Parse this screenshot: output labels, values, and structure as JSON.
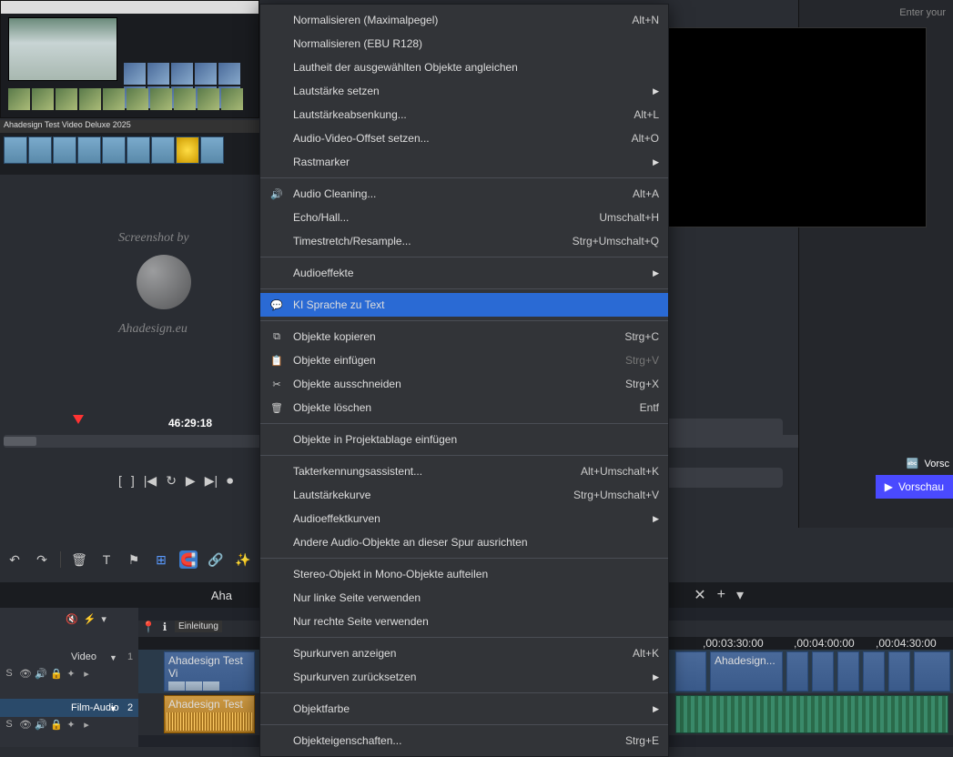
{
  "preview": {
    "title": "Ahadesign Test Video Deluxe 2025"
  },
  "watermark": {
    "top": "Screenshot by",
    "bottom": "Ahadesign.eu"
  },
  "timecode": "46:29:18",
  "rightPanel": {
    "placeholder": "Enter your",
    "translate_label": "Vorsc",
    "preview_btn": "Vorschau"
  },
  "tab": {
    "name": "Aha"
  },
  "tracks": {
    "marker_label": "Einleitung",
    "video_label": "Video",
    "video_num": "1",
    "audio_label": "Film-Audio",
    "audio_num": "2",
    "clip1": "Ahadesign Test Vi",
    "clip2": "Ahadesign Test V",
    "clip3": "Ahadesign..."
  },
  "ruler": {
    "t1": ",00:03:30:00",
    "t2": ",00:04:00:00",
    "t3": ",00:04:30:00"
  },
  "contextMenu": [
    {
      "type": "item",
      "label": "Normalisieren (Maximalpegel)",
      "shortcut": "Alt+N"
    },
    {
      "type": "item",
      "label": "Normalisieren (EBU R128)"
    },
    {
      "type": "item",
      "label": "Lautheit der ausgewählten Objekte angleichen",
      "disabled": true
    },
    {
      "type": "item",
      "label": "Lautstärke setzen",
      "submenu": true
    },
    {
      "type": "item",
      "label": "Lautstärkeabsenkung...",
      "shortcut": "Alt+L"
    },
    {
      "type": "item",
      "label": "Audio-Video-Offset setzen...",
      "shortcut": "Alt+O"
    },
    {
      "type": "item",
      "label": "Rastmarker",
      "submenu": true
    },
    {
      "type": "sep"
    },
    {
      "type": "item",
      "label": "Audio Cleaning...",
      "shortcut": "Alt+A",
      "icon": "sound"
    },
    {
      "type": "item",
      "label": "Echo/Hall...",
      "shortcut": "Umschalt+H"
    },
    {
      "type": "item",
      "label": "Timestretch/Resample...",
      "shortcut": "Strg+Umschalt+Q"
    },
    {
      "type": "sep"
    },
    {
      "type": "item",
      "label": "Audioeffekte",
      "submenu": true
    },
    {
      "type": "sep"
    },
    {
      "type": "item",
      "label": "KI Sprache zu Text",
      "highlighted": true,
      "icon": "speech"
    },
    {
      "type": "sep"
    },
    {
      "type": "item",
      "label": "Objekte kopieren",
      "shortcut": "Strg+C",
      "icon": "copy"
    },
    {
      "type": "item",
      "label": "Objekte einfügen",
      "shortcut": "Strg+V",
      "icon": "paste",
      "disabled": true
    },
    {
      "type": "item",
      "label": "Objekte ausschneiden",
      "shortcut": "Strg+X",
      "icon": "cut"
    },
    {
      "type": "item",
      "label": "Objekte löschen",
      "shortcut": "Entf",
      "icon": "delete"
    },
    {
      "type": "sep"
    },
    {
      "type": "item",
      "label": "Objekte in Projektablage einfügen"
    },
    {
      "type": "sep"
    },
    {
      "type": "item",
      "label": "Takterkennungsassistent...",
      "shortcut": "Alt+Umschalt+K"
    },
    {
      "type": "item",
      "label": "Lautstärkekurve",
      "shortcut": "Strg+Umschalt+V"
    },
    {
      "type": "item",
      "label": "Audioeffektkurven",
      "submenu": true
    },
    {
      "type": "item",
      "label": "Andere Audio-Objekte an dieser Spur ausrichten"
    },
    {
      "type": "sep"
    },
    {
      "type": "item",
      "label": "Stereo-Objekt in Mono-Objekte aufteilen"
    },
    {
      "type": "item",
      "label": "Nur linke Seite verwenden"
    },
    {
      "type": "item",
      "label": "Nur rechte Seite verwenden"
    },
    {
      "type": "sep"
    },
    {
      "type": "item",
      "label": "Spurkurven anzeigen",
      "shortcut": "Alt+K"
    },
    {
      "type": "item",
      "label": "Spurkurven zurücksetzen",
      "submenu": true
    },
    {
      "type": "sep"
    },
    {
      "type": "item",
      "label": "Objektfarbe",
      "submenu": true
    },
    {
      "type": "sep"
    },
    {
      "type": "item",
      "label": "Objekteigenschaften...",
      "shortcut": "Strg+E"
    }
  ]
}
